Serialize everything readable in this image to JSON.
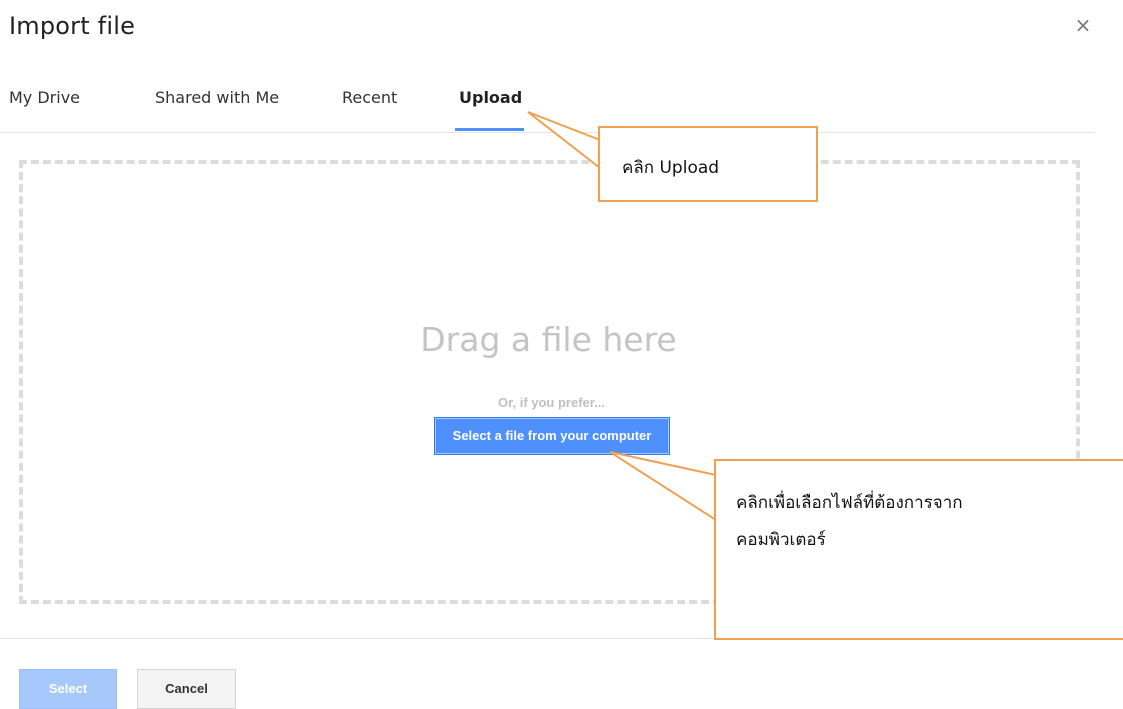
{
  "dialog": {
    "title": "Import file",
    "close_glyph": "×"
  },
  "tabs": [
    {
      "label": "My Drive",
      "active": false
    },
    {
      "label": "Shared with Me",
      "active": false
    },
    {
      "label": "Recent",
      "active": false
    },
    {
      "label": "Upload",
      "active": true
    }
  ],
  "upload": {
    "drag_text": "Drag a file here",
    "or_text": "Or, if you prefer...",
    "select_file_label": "Select a file from your computer"
  },
  "footer": {
    "select_label": "Select",
    "cancel_label": "Cancel"
  },
  "annotations": {
    "upload_callout": "คลิก Upload",
    "select_callout_line1": "คลิกเพื่อเลือกไฟล์ที่ต้องการจาก",
    "select_callout_line2": "คอมพิวเตอร์"
  },
  "colors": {
    "accent_blue": "#4d90fe",
    "disabled_blue": "#a6c8fb",
    "callout_border": "#f0a050"
  },
  "icons": {
    "close": "close-icon"
  }
}
